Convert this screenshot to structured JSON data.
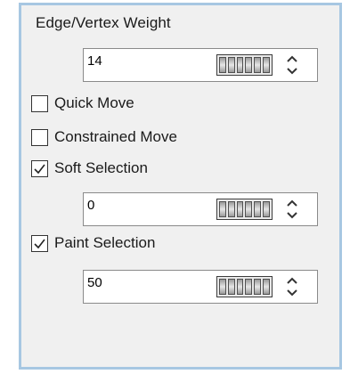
{
  "panel": {
    "title": "Edge/Vertex Weight",
    "weight_spinner": {
      "value": "14"
    },
    "quick_move": {
      "label": "Quick Move",
      "checked": false
    },
    "constrained_move": {
      "label": "Constrained Move",
      "checked": false
    },
    "soft_selection": {
      "label": "Soft Selection",
      "checked": true
    },
    "soft_selection_spinner": {
      "value": "0"
    },
    "paint_selection": {
      "label": "Paint Selection",
      "checked": true
    },
    "paint_selection_spinner": {
      "value": "50"
    }
  },
  "colors": {
    "panel_border": "#a7c7e2",
    "panel_bg": "#f0f0f0"
  }
}
